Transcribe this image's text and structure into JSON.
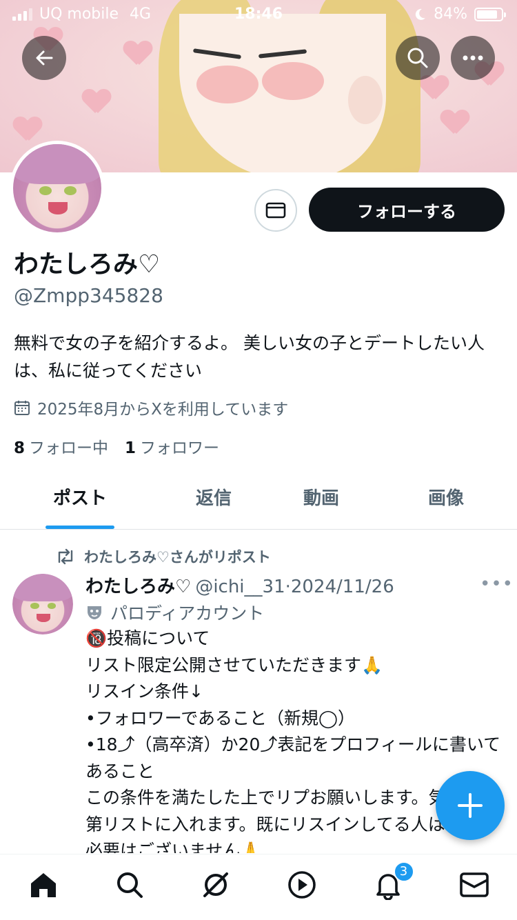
{
  "status_bar": {
    "carrier": "UQ mobile",
    "network": "4G",
    "time": "18:46",
    "battery": "84%",
    "battery_level": 0.84
  },
  "header": {
    "back_icon": "back-arrow-icon",
    "search_icon": "search-icon",
    "more_icon": "more-icon"
  },
  "profile": {
    "follow_label": "フォローする",
    "name": "わたしろみ♡",
    "handle": "@Zmpp345828",
    "bio": "無料で女の子を紹介するよ。 美しい女の子とデートしたい人は、私に従ってください",
    "joined": "2025年8月からXを利用しています",
    "following_count": "8",
    "following_label": "フォロー中",
    "followers_count": "1",
    "followers_label": "フォロワー"
  },
  "tabs": [
    {
      "label": "ポスト",
      "active": true
    },
    {
      "label": "返信",
      "active": false
    },
    {
      "label": "動画",
      "active": false
    },
    {
      "label": "画像",
      "active": false
    }
  ],
  "post": {
    "repost_text": "わたしろみ♡さんがリポスト",
    "author_name": "わたしろみ♡",
    "author_meta": "@ichi__31·2024/11/26",
    "more": "•••",
    "parody_label": "パロディアカウント",
    "body": "🔞投稿について\nリスト限定公開させていただきます🙏\nリスイン条件↓\n•フォロワーであること（新規◯）\n•18⤴（高卒済）か20⤴表記をプロフィールに書いてあること\nこの条件を満たした上でリプお願いします。気づき次第リストに入れます。既にリスインしてる人はリプの必要はございません🙏"
  },
  "bottom_nav": {
    "items": [
      "home-icon",
      "search-icon",
      "grok-icon",
      "video-icon",
      "notifications-icon",
      "messages-icon"
    ],
    "notification_badge": "3"
  },
  "colors": {
    "accent": "#1d9bf0",
    "text": "#0f1419",
    "secondary": "#536471"
  }
}
